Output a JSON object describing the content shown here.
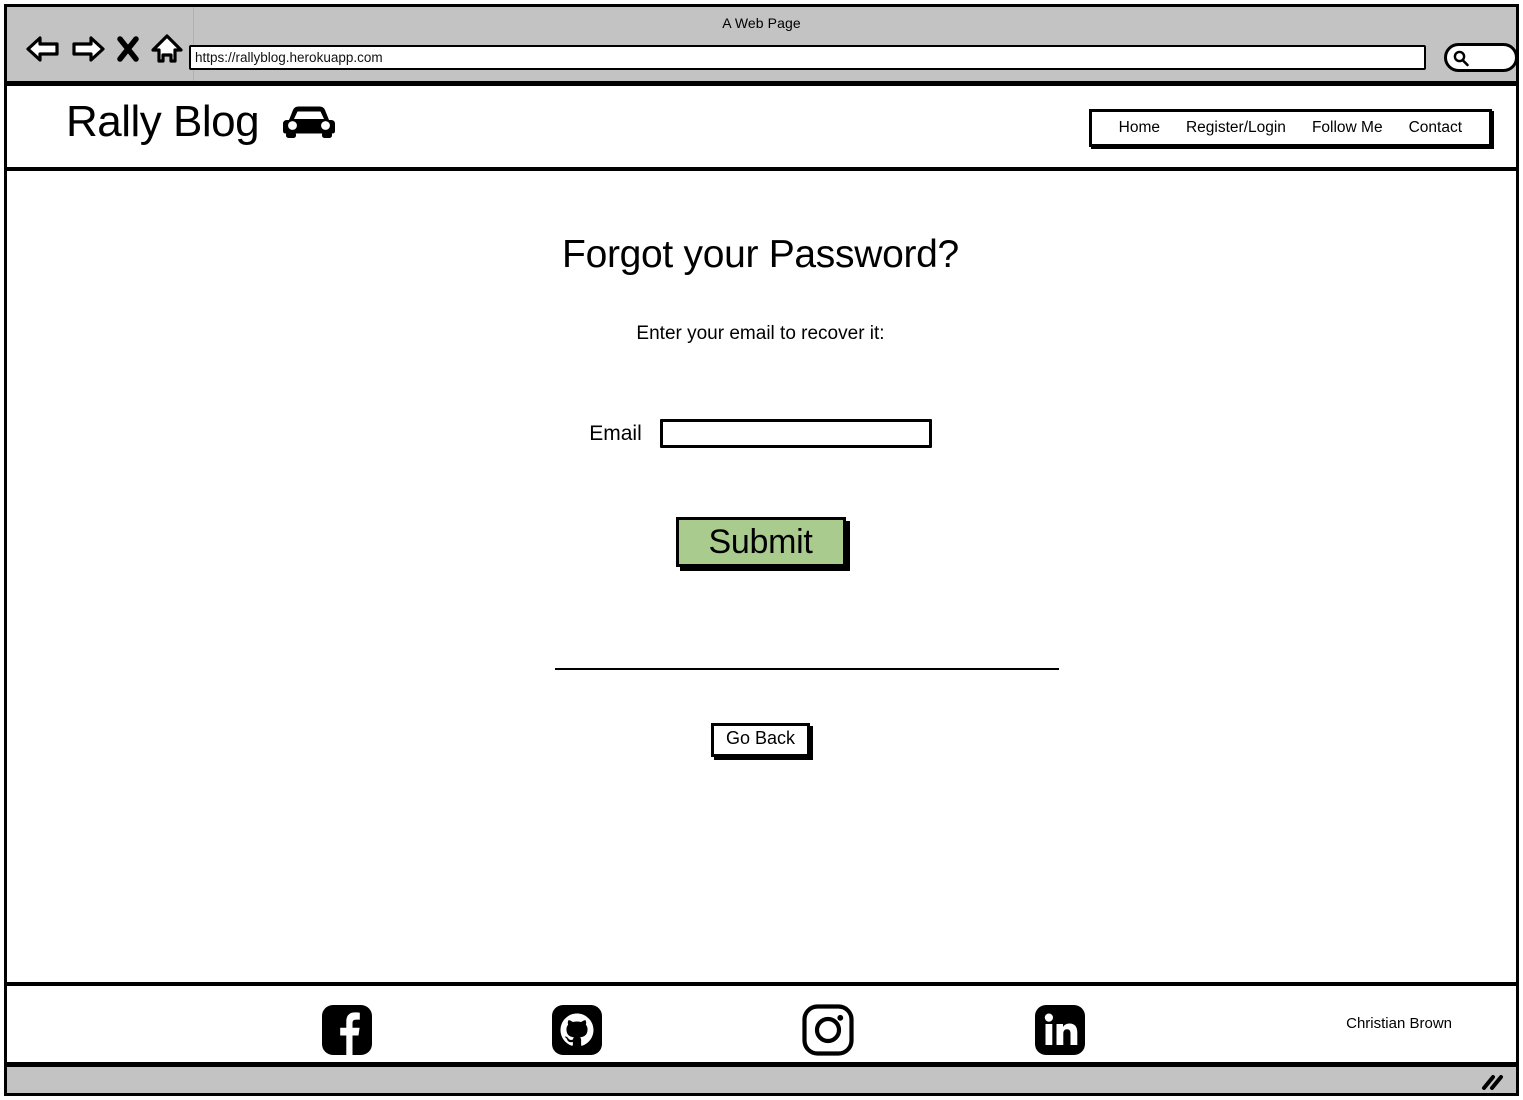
{
  "browser": {
    "window_title": "A Web Page",
    "url": "https://rallyblog.herokuapp.com",
    "url_placeholder": "Enter URL",
    "icons": {
      "back": "back-arrow-icon",
      "forward": "forward-arrow-icon",
      "stop": "close-x-icon",
      "home": "home-icon",
      "search": "search-icon",
      "resize": "resize-grip-icon"
    }
  },
  "site": {
    "brand": {
      "name": "Rally Blog",
      "logo_icon": "car-icon"
    },
    "nav": [
      {
        "label": "Home"
      },
      {
        "label": "Register/Login"
      },
      {
        "label": "Follow Me"
      },
      {
        "label": "Contact"
      }
    ]
  },
  "main": {
    "title": "Forgot your Password?",
    "subtitle": "Enter your email to recover it:",
    "email_label": "Email",
    "email_value": "",
    "email_placeholder": "",
    "submit_label": "Submit",
    "go_back_label": "Go Back"
  },
  "footer": {
    "social": [
      {
        "name": "facebook-icon"
      },
      {
        "name": "github-icon"
      },
      {
        "name": "instagram-icon"
      },
      {
        "name": "linkedin-icon"
      }
    ],
    "credit": "Christian Brown"
  },
  "colors": {
    "submit_green": "#a9cb8d",
    "chrome_gray": "#c3c3c3",
    "outline_black": "#000000",
    "page_white": "#ffffff"
  }
}
